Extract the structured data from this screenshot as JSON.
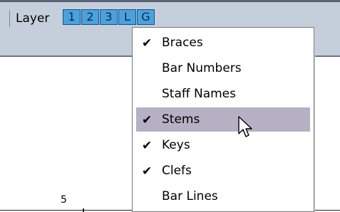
{
  "toolbar": {
    "layer_label": "Layer",
    "layer_buttons": [
      "1",
      "2",
      "3",
      "L",
      "G"
    ]
  },
  "score": {
    "bar_number": "5"
  },
  "menu": {
    "items": [
      {
        "label": "Braces",
        "checked": true,
        "highlighted": false
      },
      {
        "label": "Bar Numbers",
        "checked": false,
        "highlighted": false
      },
      {
        "label": "Staff Names",
        "checked": false,
        "highlighted": false
      },
      {
        "label": "Stems",
        "checked": true,
        "highlighted": true
      },
      {
        "label": "Keys",
        "checked": true,
        "highlighted": false
      },
      {
        "label": "Clefs",
        "checked": true,
        "highlighted": false
      },
      {
        "label": "Bar Lines",
        "checked": false,
        "highlighted": false
      }
    ],
    "check_glyph": "✔",
    "highlight_color": "#b5b0c3"
  },
  "icons": {
    "cursor": "arrow-cursor-icon",
    "check": "checkmark-icon"
  }
}
